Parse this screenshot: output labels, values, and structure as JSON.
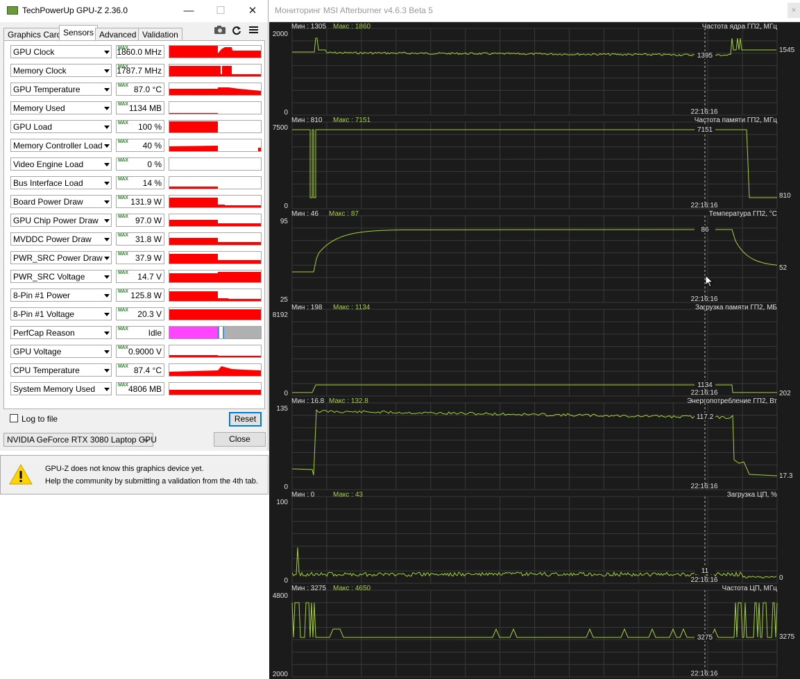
{
  "gpuz": {
    "title": "TechPowerUp GPU-Z 2.36.0",
    "window_controls": {
      "minimize": "—",
      "maximize": "☐",
      "close": "✕"
    },
    "tabs": [
      "Graphics Card",
      "Sensors",
      "Advanced",
      "Validation"
    ],
    "active_tab": "Sensors",
    "toolbar_icons": [
      "camera-icon",
      "refresh-icon",
      "menu-icon"
    ],
    "max_tag": "MAX",
    "sensors": [
      {
        "name": "GPU Clock",
        "value": "1860.0 MHz"
      },
      {
        "name": "Memory Clock",
        "value": "1787.7 MHz"
      },
      {
        "name": "GPU Temperature",
        "value": "87.0 °C"
      },
      {
        "name": "Memory Used",
        "value": "1134 MB"
      },
      {
        "name": "GPU Load",
        "value": "100 %"
      },
      {
        "name": "Memory Controller Load",
        "value": "40 %"
      },
      {
        "name": "Video Engine Load",
        "value": "0 %"
      },
      {
        "name": "Bus Interface Load",
        "value": "14 %"
      },
      {
        "name": "Board Power Draw",
        "value": "131.9 W"
      },
      {
        "name": "GPU Chip Power Draw",
        "value": "97.0 W"
      },
      {
        "name": "MVDDC Power Draw",
        "value": "31.8 W"
      },
      {
        "name": "PWR_SRC Power Draw",
        "value": "37.9 W"
      },
      {
        "name": "PWR_SRC Voltage",
        "value": "14.7 V"
      },
      {
        "name": "8-Pin #1 Power",
        "value": "125.8 W"
      },
      {
        "name": "8-Pin #1 Voltage",
        "value": "20.3 V"
      },
      {
        "name": "PerfCap Reason",
        "value": "Idle"
      },
      {
        "name": "GPU Voltage",
        "value": "0.9000 V"
      },
      {
        "name": "CPU Temperature",
        "value": "87.4 °C"
      },
      {
        "name": "System Memory Used",
        "value": "4806 MB"
      }
    ],
    "log_to_file_label": "Log to file",
    "log_to_file_checked": false,
    "reset_label": "Reset",
    "gpu_selected": "NVIDIA GeForce RTX 3080 Laptop GPU",
    "close_label": "Close",
    "colors": {
      "graph": "#ff0000",
      "perfcap_idle": "#ff44ff",
      "perfcap_other": "#4a90e2",
      "perfcap_none": "#b0b0b0"
    }
  },
  "notice": {
    "line1": "GPU-Z does not know this graphics device yet.",
    "line2": "Help the community by submitting a validation from the 4th tab."
  },
  "afterburner": {
    "title": "Мониторинг MSI Afterburner v4.6.3 Beta 5",
    "close_glyph": "×",
    "min_prefix": "Мин : ",
    "max_prefix": "Макс : ",
    "time_label": "22:16:16",
    "colors": {
      "background": "#1b1b1b",
      "trace": "#a4d33a",
      "grid": "#3a3a3a",
      "text": "#e0e0e0"
    },
    "graphs": [
      {
        "title": "Частота ядра ГП2, МГц",
        "min": "1305",
        "max": "1860",
        "ymax": "2000",
        "ymin": "0",
        "cursor_value": "1395",
        "current": "1545"
      },
      {
        "title": "Частота памяти ГП2, МГц",
        "min": "810",
        "max": "7151",
        "ymax": "7500",
        "ymin": "0",
        "cursor_value": "7151",
        "current": "810"
      },
      {
        "title": "Температура ГП2, °С",
        "min": "46",
        "max": "87",
        "ymax": "95",
        "ymin": "25",
        "cursor_value": "86",
        "current": "52"
      },
      {
        "title": "Загрузка памяти ГП2, МБ",
        "min": "198",
        "max": "1134",
        "ymax": "8192",
        "ymin": "0",
        "cursor_value": "1134",
        "current": "202"
      },
      {
        "title": "Энергопотребление ГП2, Вт",
        "min": "16.8",
        "max": "132.8",
        "ymax": "135",
        "ymin": "0",
        "cursor_value": "117.2",
        "current": "17.3"
      },
      {
        "title": "Загрузка ЦП, %",
        "min": "0",
        "max": "43",
        "ymax": "100",
        "ymin": "0",
        "cursor_value": "11",
        "current": "0"
      },
      {
        "title": "Частота ЦП, МГц",
        "min": "3275",
        "max": "4650",
        "ymax": "4800",
        "ymin": "2000",
        "cursor_value": "3275",
        "current": "3275"
      }
    ]
  }
}
